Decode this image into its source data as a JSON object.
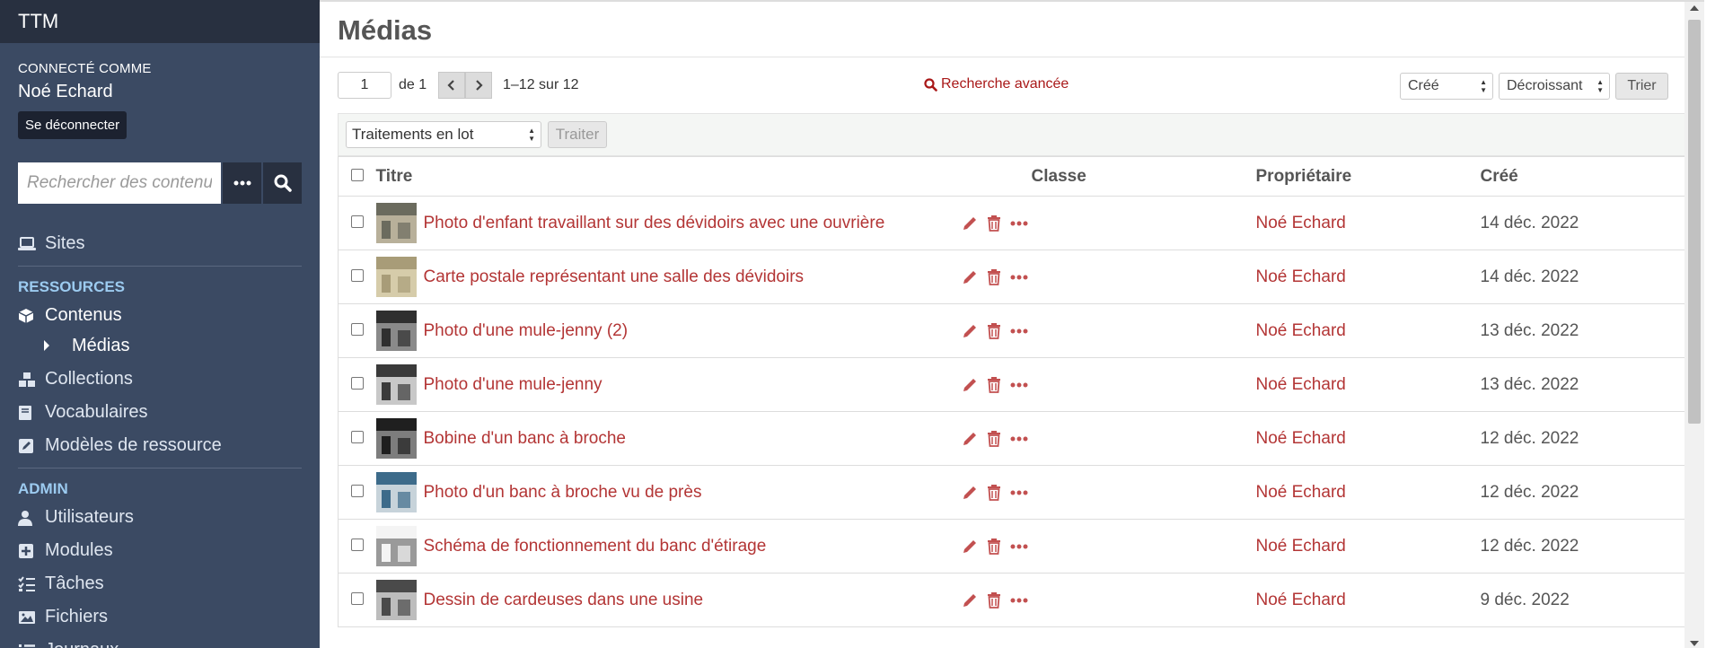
{
  "sidebar": {
    "brand": "TTM",
    "connected_label": "Connecté comme",
    "user_name": "Noé Echard",
    "logout": "Se déconnecter",
    "search_placeholder": "Rechercher des contenus",
    "sites": "Sites",
    "resources_title": "Ressources",
    "contents": "Contenus",
    "medias": "Médias",
    "collections": "Collections",
    "vocabularies": "Vocabulaires",
    "resource_templates": "Modèles de ressource",
    "admin_title": "Admin",
    "users": "Utilisateurs",
    "modules": "Modules",
    "tasks": "Tâches",
    "files": "Fichiers",
    "logs": "Journaux"
  },
  "header": {
    "title": "Médias"
  },
  "pagination": {
    "page": "1",
    "of_label": "de 1",
    "range": "1–12 sur 12"
  },
  "advanced_search": "Recherche avancée",
  "sort": {
    "by": "Créé",
    "order": "Décroissant",
    "button": "Trier"
  },
  "batch": {
    "select": "Traitements en lot",
    "button": "Traiter"
  },
  "table": {
    "headers": {
      "title": "Titre",
      "class": "Classe",
      "owner": "Propriétaire",
      "created": "Créé"
    },
    "rows": [
      {
        "title": "Photo d'enfant travaillant sur des dévidoirs avec une ouvrière",
        "class": "",
        "owner": "Noé Echard",
        "created": "14 déc. 2022"
      },
      {
        "title": "Carte postale représentant une salle des dévidoirs",
        "class": "",
        "owner": "Noé Echard",
        "created": "14 déc. 2022"
      },
      {
        "title": "Photo d'une mule-jenny (2)",
        "class": "",
        "owner": "Noé Echard",
        "created": "13 déc. 2022"
      },
      {
        "title": "Photo d'une mule-jenny",
        "class": "",
        "owner": "Noé Echard",
        "created": "13 déc. 2022"
      },
      {
        "title": "Bobine d'un banc à broche",
        "class": "",
        "owner": "Noé Echard",
        "created": "12 déc. 2022"
      },
      {
        "title": "Photo d'un banc à broche vu de près",
        "class": "",
        "owner": "Noé Echard",
        "created": "12 déc. 2022"
      },
      {
        "title": "Schéma de fonctionnement du banc d'étirage",
        "class": "",
        "owner": "Noé Echard",
        "created": "12 déc. 2022"
      },
      {
        "title": "Dessin de cardeuses dans une usine",
        "class": "",
        "owner": "Noé Echard",
        "created": "9 déc. 2022"
      }
    ]
  },
  "colors": {
    "sidebar_bg": "#3b4a63",
    "brand_bg": "#283040",
    "link": "#b33535",
    "section_title": "#9ccbf0"
  }
}
